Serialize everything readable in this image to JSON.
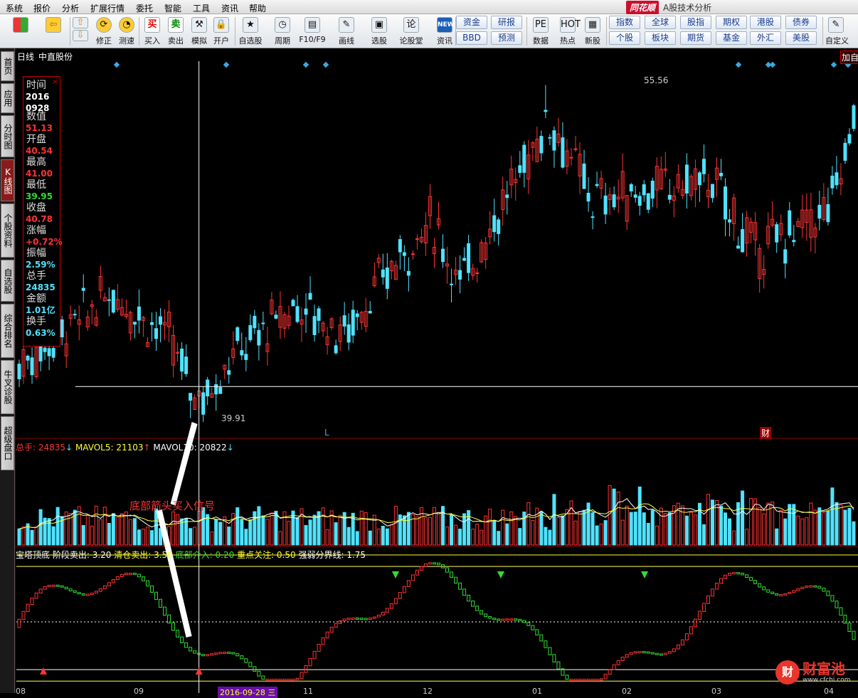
{
  "menu": [
    "系统",
    "报价",
    "分析",
    "扩展行情",
    "委托",
    "智能",
    "工具",
    "资讯",
    "帮助"
  ],
  "brand": {
    "logo": "同花顺",
    "subtitle": "A股技术分析"
  },
  "toolbar": {
    "buttons": [
      "修正",
      "测速",
      "买入",
      "卖出",
      "模拟",
      "开户",
      "自选股",
      "周期",
      "F10/F9",
      "画线",
      "选股",
      "论股堂",
      "资讯",
      "数据",
      "热点",
      "新股",
      "自定义"
    ],
    "icons": {
      "buy": "买",
      "sell": "卖",
      "news": "NEWS"
    },
    "grid_left": [
      "资金",
      "BBD",
      "研报",
      "预测"
    ],
    "grid_right": [
      "指数",
      "个股",
      "全球",
      "板块",
      "股指",
      "期货",
      "期权",
      "基金",
      "港股",
      "外汇",
      "债券",
      "美股"
    ]
  },
  "sidetabs": [
    "首页",
    "应用",
    "分时图",
    "K线图",
    "个股资料",
    "自选股",
    "综合排名",
    "牛叉诊股",
    "超级盘口"
  ],
  "chart_header": {
    "period": "日线",
    "name": "中直股份",
    "add": "加自"
  },
  "info": {
    "close_x": "×",
    "rows": [
      {
        "k": "时间",
        "v": "2016",
        "v2": "0928",
        "color": "#ffffff"
      },
      {
        "k": "数值",
        "v": "51.13",
        "color": "#ff3333"
      },
      {
        "k": "开盘",
        "v": "40.54",
        "color": "#ff3333"
      },
      {
        "k": "最高",
        "v": "41.00",
        "color": "#ff3333"
      },
      {
        "k": "最低",
        "v": "39.95",
        "color": "#33dd33"
      },
      {
        "k": "收盘",
        "v": "40.78",
        "color": "#ff3333"
      },
      {
        "k": "涨幅",
        "v": "+0.72%",
        "color": "#ff3333"
      },
      {
        "k": "振幅",
        "v": "2.59%",
        "color": "#4fe3ff"
      },
      {
        "k": "总手",
        "v": "24835",
        "color": "#4fe3ff"
      },
      {
        "k": "金额",
        "v": "1.01亿",
        "color": "#4fe3ff"
      },
      {
        "k": "换手",
        "v": "0.63%",
        "color": "#4fe3ff"
      }
    ]
  },
  "annotations": {
    "high": "55.56",
    "low": "39.91",
    "l_marker": "L",
    "cai_marker": "财",
    "arrow_text": "底部箭头买入信号",
    "crosshair_date": "2016-09-28 三",
    "watermark": "财富池",
    "watermark_url": "www.cfchi.com"
  },
  "volume_legend": {
    "vol": "总手: 24835",
    "ma5": "MAVOL5: 21103",
    "ma10": "MAVOL10: 20822"
  },
  "indicator_legend": {
    "name": "宝塔顶底",
    "p1": "阶段卖出: 3.20",
    "p2": "清仓卖出: 3.50",
    "p3": "底部介入: 0.20",
    "p4": "重点关注: 0.50",
    "p5": "强弱分界线: 1.75"
  },
  "xaxis": [
    "08",
    "09",
    "2016-09-28 三",
    "11",
    "12",
    "01",
    "02",
    "03",
    "04"
  ],
  "colors": {
    "up": "#ff3333",
    "down": "#4fe3ff",
    "grid": "#7a0000",
    "ma5": "#ffffff",
    "ma10": "#ffff33"
  },
  "chart_data": {
    "type": "candlestick",
    "price_ylim": [
      38.5,
      56.3
    ],
    "high": 55.56,
    "low": 39.91,
    "crosshair_value": 41.0,
    "volume_ylim": [
      0,
      60000
    ],
    "indicator_ylim": [
      0,
      3.5
    ],
    "indicator_lines": [
      3.2,
      3.5,
      0.2,
      0.5,
      1.75
    ]
  }
}
